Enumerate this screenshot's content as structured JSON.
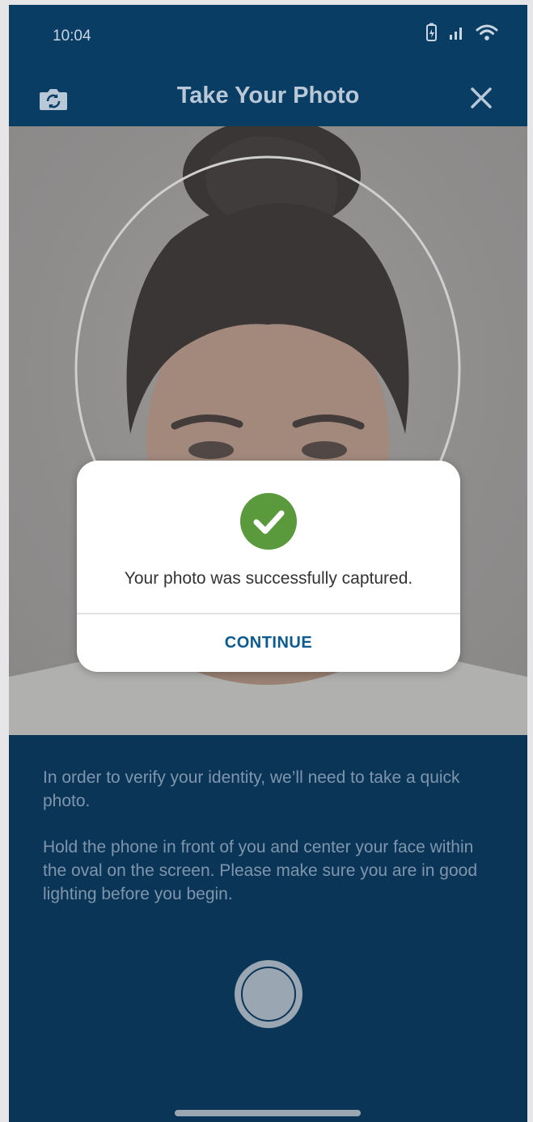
{
  "status_bar": {
    "time": "10:04",
    "icons": [
      "battery-charging-icon",
      "signal-icon",
      "wifi-icon"
    ]
  },
  "header": {
    "title": "Take Your Photo",
    "left_icon": "flip-camera-icon",
    "right_icon": "close-icon"
  },
  "dialog": {
    "icon": "check-icon",
    "message": "Your photo was successfully captured.",
    "button_label": "CONTINUE"
  },
  "instructions": {
    "paragraph_1": "In order to verify your identity, we’ll need to take a quick photo.",
    "paragraph_2": "Hold the phone in front of you and center your face within the oval on the screen. Please make sure you are in good lighting before you begin."
  },
  "colors": {
    "primary": "#0a3d64",
    "panel": "#0b3557",
    "success": "#5a9a3c",
    "button_text": "#0d5a8f"
  }
}
